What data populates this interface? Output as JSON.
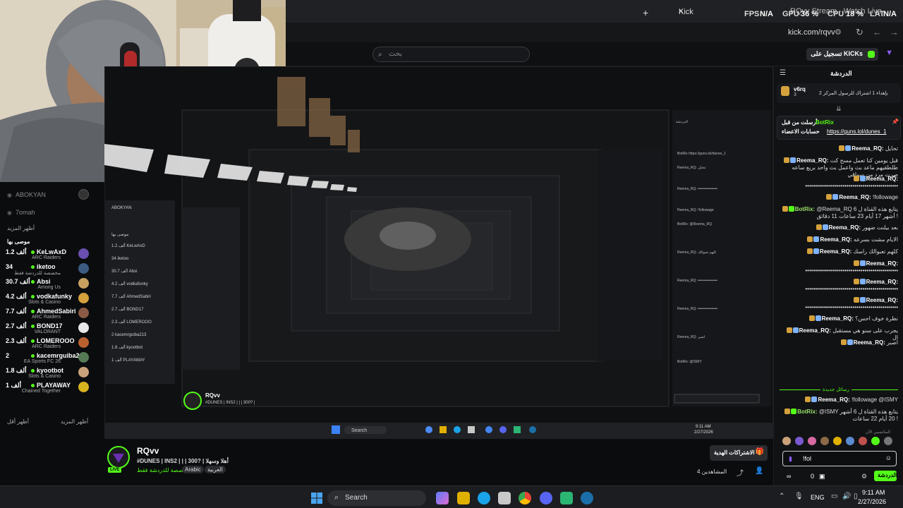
{
  "browser": {
    "tab_label": "Kick",
    "tab_other": "RQvv Stream - Watch Live",
    "url": "kick.com/rqvv",
    "overlay": {
      "fps_label": "FPS",
      "fps_value": "N/A",
      "gpu_label": "GPU",
      "gpu_value": "36 %",
      "cpu_label": "CPU",
      "cpu_value": "18 %",
      "lat_label": "LAT",
      "lat_value": "N/A"
    }
  },
  "header": {
    "search_placeholder": "بحث",
    "login_label": "تسجيل على KICKs"
  },
  "sidebar": {
    "top_items": [
      {
        "name": "ABOKYAN"
      },
      {
        "name": "7omah"
      }
    ],
    "show_more": "أظهر المزيد",
    "recommended_title": "موصى بها",
    "items": [
      {
        "viewers": "1.2 ألف",
        "name": "KeLwAxD",
        "category": "ARC Raiders",
        "color": "#6b4fb0"
      },
      {
        "viewers": "34",
        "name": "iketoo",
        "category": "مخصصة للدردشة فقط",
        "color": "#3d5a80"
      },
      {
        "viewers": "30.7 ألف",
        "name": "Absi",
        "category": "Among Us",
        "color": "#c8a060"
      },
      {
        "viewers": "4.2 ألف",
        "name": "vodkafunky",
        "category": "Slots & Casino",
        "color": "#d4a13c"
      },
      {
        "viewers": "7.7 ألف",
        "name": "AhmedSabiri",
        "category": "ARC Raiders",
        "color": "#8a5a44"
      },
      {
        "viewers": "2.7 ألف",
        "name": "BOND17",
        "category": "VALORANT",
        "color": "#e8e8e8"
      },
      {
        "viewers": "2.3 ألف",
        "name": "LOMEROOO",
        "category": "ARC Raiders",
        "color": "#b9602f"
      },
      {
        "viewers": "2",
        "name": "kacemrguiba213",
        "category": "EA Sports FC 26",
        "color": "#567a56"
      },
      {
        "viewers": "1.8 ألف",
        "name": "kyootbot",
        "category": "Slots & Casino",
        "color": "#c9a27a"
      },
      {
        "viewers": "1 ألف",
        "name": "PLAYAWAY",
        "category": "Chained Together",
        "color": "#d9b21f"
      }
    ],
    "show_more_bottom": "أظهر المزيد",
    "show_less": "أظهر أقل"
  },
  "stream": {
    "channel": "RQvv",
    "title": "#DUNES | INS2 | | | 300? | أهلا وسهلا",
    "category": "مخصصة للدردشة فقط",
    "tags": [
      "Arabic",
      "العربية"
    ],
    "live_badge": "LIVE",
    "subscribe_label": "الاشتراكات الهدية",
    "viewers_label": "المشاهدين 4"
  },
  "chat": {
    "title": "الدردشة",
    "pinned_user": "v6rq",
    "pinned_text": "بإهداء 1 اشتراك للرسول المركز 2",
    "pinned_count": "3",
    "announce_label": "أرسلت من قبل",
    "announce_user": "BotRix",
    "announce_text": "حسابات الاعضاء",
    "announce_link": "https://guns.lol/dunes_1",
    "messages": [
      {
        "user": "Reema_RQ:",
        "text": "تحايل",
        "bot": false,
        "color": "#7fb2ff"
      },
      {
        "user": "Reema_RQ:",
        "text": "قبل يومين كنا تعمل مسح كت طلطقيهم ماعد بث واعمل بث واحد بريع ساعه صرت مرد من سواقي",
        "bot": false,
        "color": "#7fb2ff"
      },
      {
        "user": "Reema_RQ:",
        "text": "•••••••••••••••••••••••••••••••••••••••••••••••",
        "bot": false,
        "color": "#7fb2ff"
      },
      {
        "user": "Reema_RQ:",
        "text": "!followage",
        "bot": false,
        "color": "#7fb2ff"
      },
      {
        "user": "BotRix:",
        "text": "@Reema_RQ يتابع هذه القناة ل 6 أشهر 17 أيام 23 ساعات 11 دقائق !",
        "bot": true,
        "color": "#53fc18"
      },
      {
        "user": "Reema_RQ:",
        "text": "بعد بيلنت ضهور",
        "bot": false,
        "color": "#7fb2ff"
      },
      {
        "user": "Reema_RQ:",
        "text": "الايام مشت بسرعه",
        "bot": false,
        "color": "#7fb2ff"
      },
      {
        "user": "Reema_RQ:",
        "text": "كلهم تعبوالك راسك",
        "bot": false,
        "color": "#7fb2ff"
      },
      {
        "user": "Reema_RQ:",
        "text": "•••••••••••••••••••••••••••••••••••••••••••••••",
        "bot": false,
        "color": "#7fb2ff"
      },
      {
        "user": "Reema_RQ:",
        "text": "•••••••••••••••••••••••••••••••••••••••••••••••",
        "bot": false,
        "color": "#7fb2ff"
      },
      {
        "user": "Reema_RQ:",
        "text": "•••••••••••••••••••••••••••••••••••••••••••••••",
        "bot": false,
        "color": "#7fb2ff"
      },
      {
        "user": "Reema_RQ:",
        "text": "نظرة خوف احس؟",
        "bot": false,
        "color": "#7fb2ff"
      },
      {
        "user": "Reema_RQ:",
        "text": "يجرب على سنو هي مستقبل ال",
        "bot": false,
        "color": "#7fb2ff"
      },
      {
        "user": "Reema_RQ:",
        "text": "اصبر",
        "bot": false,
        "color": "#7fb2ff"
      }
    ],
    "new_messages": "رسائل جديدة",
    "after_messages": [
      {
        "user": "Reema_RQ:",
        "text": "!followage @ISMY",
        "bot": false,
        "color": "#7fb2ff"
      },
      {
        "user": "BotRix:",
        "text": "@ISMY يتابع هذه القناة ل 6 أشهر 20 أيام 22 ساعات !",
        "bot": true,
        "color": "#53fc18"
      }
    ],
    "contributors_label": "المكتسين الآن",
    "input_value": "!fol",
    "points": "0",
    "send_label": "الدردشة"
  },
  "taskbar": {
    "search_label": "Search",
    "lang": "ENG",
    "time": "9:11 AM",
    "date": "2/27/2026"
  },
  "colors": {
    "kick_green": "#53fc18",
    "bg": "#0b0c0e"
  }
}
